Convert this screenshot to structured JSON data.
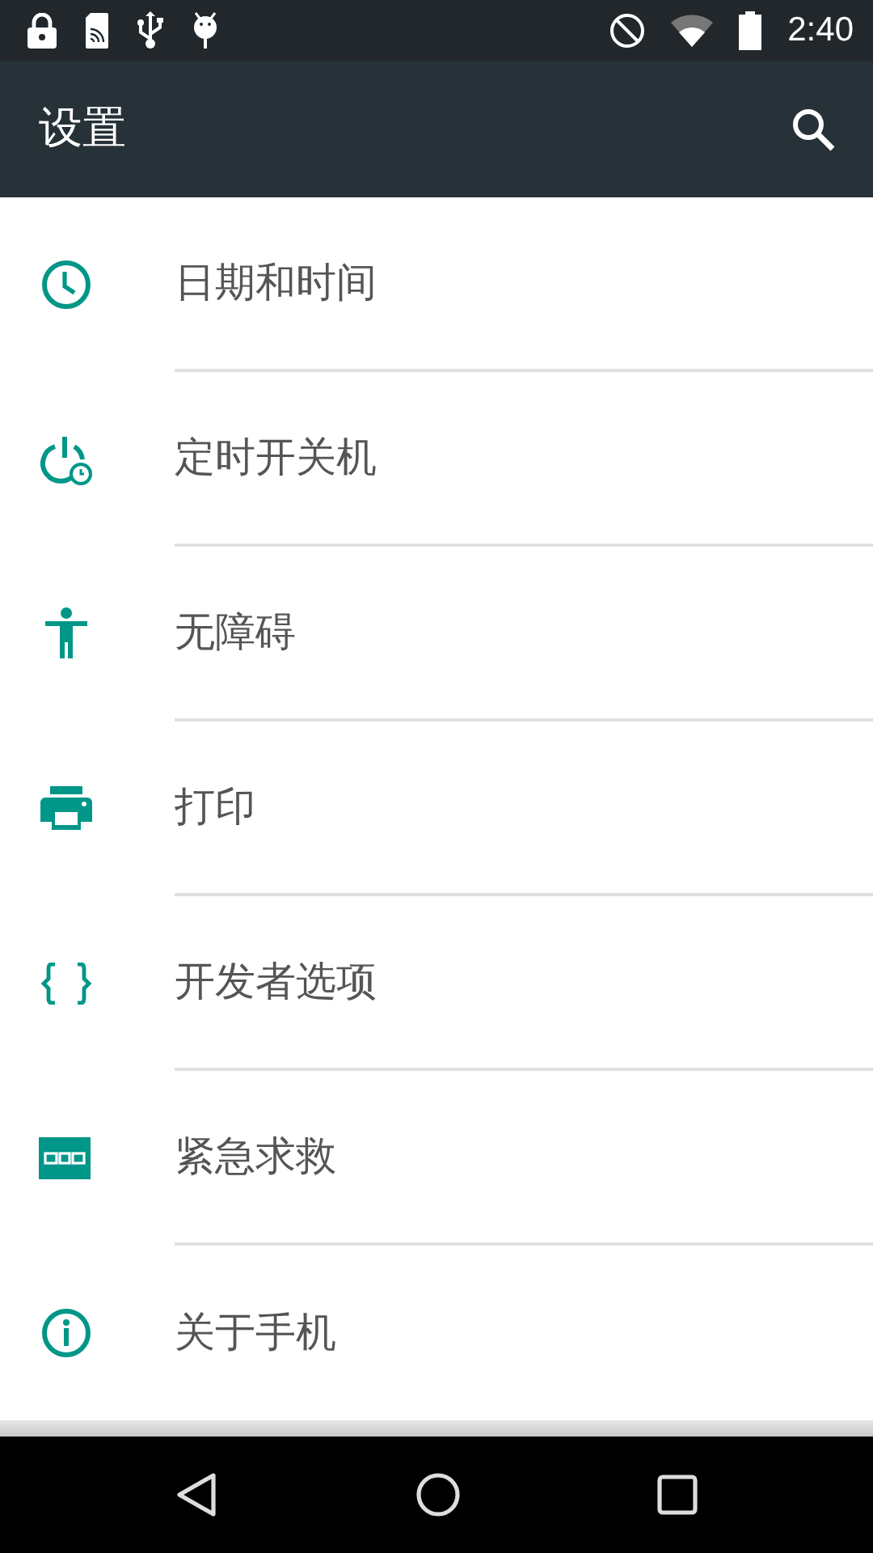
{
  "status_bar": {
    "time": "2:40"
  },
  "app_bar": {
    "title": "设置"
  },
  "items": [
    {
      "label": "日期和时间"
    },
    {
      "label": "定时开关机"
    },
    {
      "label": "无障碍"
    },
    {
      "label": "打印"
    },
    {
      "label": "开发者选项"
    },
    {
      "label": "紧急求救"
    },
    {
      "label": "关于手机"
    }
  ]
}
